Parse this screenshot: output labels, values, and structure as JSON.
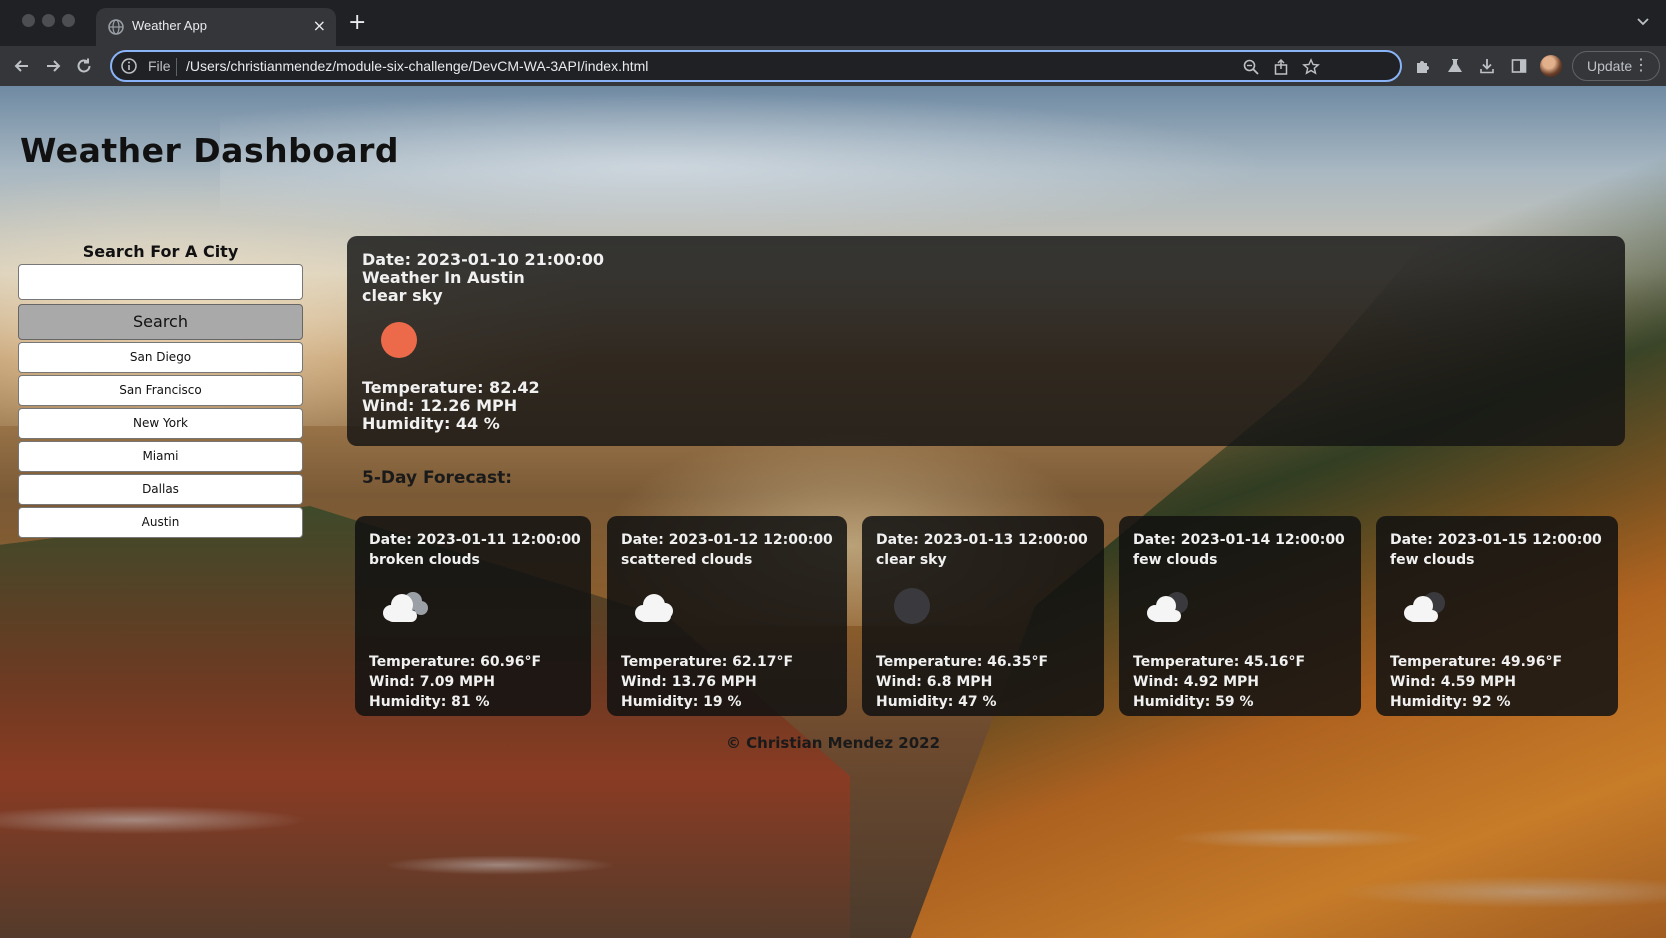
{
  "browser": {
    "tab_title": "Weather App",
    "new_tab_glyph": "+",
    "close_glyph": "×",
    "address_prefix": "File",
    "address_url": "/Users/christianmendez/module-six-challenge/DevCM-WA-3API/index.html",
    "update_label": "Update",
    "menu_glyph": "⋮",
    "icons": [
      "back-icon",
      "forward-icon",
      "reload-icon",
      "info-icon",
      "zoom-icon",
      "share-icon",
      "star-icon",
      "extensions-icon",
      "labs-icon",
      "download-icon",
      "sidepanel-icon",
      "avatar",
      "chevron-down-icon"
    ]
  },
  "page": {
    "title": "Weather Dashboard",
    "search": {
      "label": "Search For A City",
      "input_value": "",
      "button_label": "Search"
    },
    "history": [
      "San Diego",
      "San Francisco",
      "New York",
      "Miami",
      "Dallas",
      "Austin"
    ],
    "current": {
      "date": "Date: 2023-01-10 21:00:00",
      "city": "Weather In Austin",
      "description": "clear sky",
      "icon": "sun-icon",
      "icon_color": "#ec6a4a",
      "temperature": "Temperature: 82.42",
      "wind": "Wind: 12.26 MPH",
      "humidity": "Humidity: 44 %"
    },
    "forecast_title": "5-Day Forecast:",
    "forecast": [
      {
        "date": "Date: 2023-01-11 12:00:00",
        "description": "broken clouds",
        "icon": "broken-clouds-icon",
        "temperature": "Temperature: 60.96°F",
        "wind": "Wind: 7.09 MPH",
        "humidity": "Humidity: 81 %"
      },
      {
        "date": "Date: 2023-01-12 12:00:00",
        "description": "scattered clouds",
        "icon": "scattered-clouds-icon",
        "temperature": "Temperature: 62.17°F",
        "wind": "Wind: 13.76 MPH",
        "humidity": "Humidity: 19 %"
      },
      {
        "date": "Date: 2023-01-13 12:00:00",
        "description": "clear sky",
        "icon": "clear-sky-night-icon",
        "temperature": "Temperature: 46.35°F",
        "wind": "Wind: 6.8 MPH",
        "humidity": "Humidity: 47 %"
      },
      {
        "date": "Date: 2023-01-14 12:00:00",
        "description": "few clouds",
        "icon": "few-clouds-icon",
        "temperature": "Temperature: 45.16°F",
        "wind": "Wind: 4.92 MPH",
        "humidity": "Humidity: 59 %"
      },
      {
        "date": "Date: 2023-01-15 12:00:00",
        "description": "few clouds",
        "icon": "few-clouds-icon",
        "temperature": "Temperature: 49.96°F",
        "wind": "Wind: 4.59 MPH",
        "humidity": "Humidity: 92 %"
      }
    ],
    "footer": "© Christian Mendez 2022"
  }
}
